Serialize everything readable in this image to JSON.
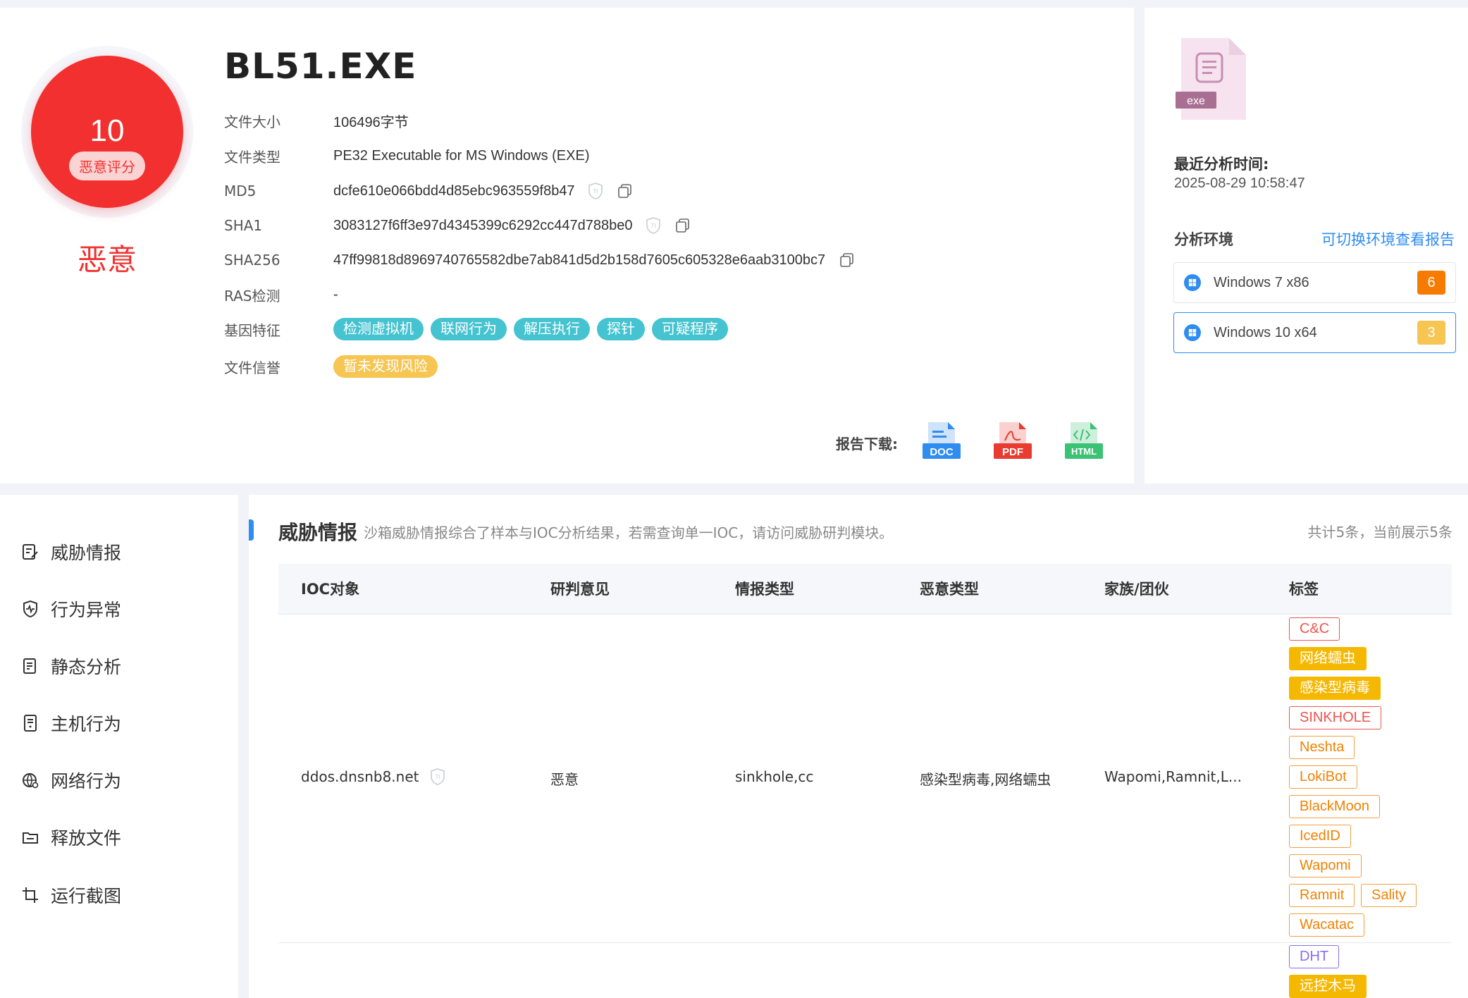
{
  "file": {
    "score": "10",
    "score_label": "恶意评分",
    "verdict": "恶意",
    "title": "BL51.EXE",
    "rows": [
      {
        "label": "文件大小",
        "value": "106496字节"
      },
      {
        "label": "文件类型",
        "value": "PE32 Executable for MS Windows (EXE)"
      },
      {
        "label": "MD5",
        "value": "dcfe610e066bdd4d85ebc963559f8b47"
      },
      {
        "label": "SHA1",
        "value": "3083127f6ff3e97d4345399c6292cc447d788be0"
      },
      {
        "label": "SHA256",
        "value": "47ff99818d8969740765582dbe7ab841d5d2b158d7605c605328e6aab3100bc7"
      },
      {
        "label": "RAS检测",
        "value": "-"
      },
      {
        "label": "基因特征",
        "value": ""
      },
      {
        "label": "文件信誉",
        "value": ""
      }
    ],
    "gene_tags": [
      "检测虚拟机",
      "联网行为",
      "解压执行",
      "探针",
      "可疑程序"
    ],
    "reputation": "暂未发现风险",
    "report_download_label": "报告下载:",
    "download_formats": [
      "DOC",
      "PDF",
      "HTML"
    ],
    "ext_label": "exe"
  },
  "analysis": {
    "recent_label": "最近分析时间:",
    "recent_time": "2025-08-29 10:58:47",
    "env_label": "分析环境",
    "env_link": "可切换环境查看报告",
    "envs": [
      {
        "name": "Windows 7 x86",
        "count": "6",
        "color": "#f57c00"
      },
      {
        "name": "Windows 10 x64",
        "count": "3",
        "color": "#f6c552"
      }
    ]
  },
  "sidebar": {
    "items": [
      "威胁情报",
      "行为异常",
      "静态分析",
      "主机行为",
      "网络行为",
      "释放文件",
      "运行截图"
    ]
  },
  "threat": {
    "title": "威胁情报",
    "desc": "沙箱威胁情报综合了样本与IOC分析结果，若需查询单一IOC，请访问威胁研判模块。",
    "count": "共计5条，当前展示5条",
    "columns": [
      "IOC对象",
      "研判意见",
      "情报类型",
      "恶意类型",
      "家族/团伙",
      "标签"
    ],
    "row": {
      "ioc": "ddos.dnsnb8.net",
      "opinion": "恶意",
      "intel_type": "sinkhole,cc",
      "malware_type": "感染型病毒,网络蠕虫",
      "family": "Wapomi,Ramnit,L..."
    },
    "tags": [
      "C&C",
      "网络蠕虫",
      "感染型病毒",
      "SINKHOLE",
      "Neshta",
      "LokiBot",
      "BlackMoon",
      "IcedID",
      "Wapomi",
      "Ramnit",
      "Sality",
      "Wacatac"
    ],
    "next_tags": [
      "DHT",
      "远控木马"
    ]
  }
}
